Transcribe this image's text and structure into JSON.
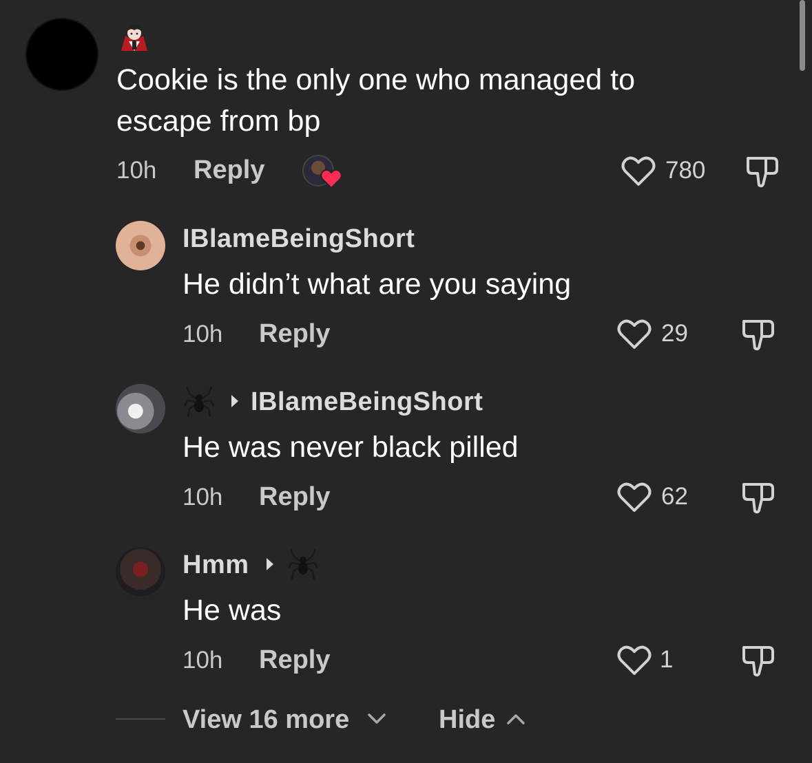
{
  "colors": {
    "background": "#262626",
    "text": "#ffffff",
    "muted": "#c9c9c9",
    "heart_badge": "#fe2c55"
  },
  "comments": [
    {
      "emoji_icon": "vampire-icon",
      "text_line1": "Cookie is the only one who managed to",
      "text_line2": "escape from bp",
      "time": "10h",
      "reply": "Reply",
      "likes": "780",
      "creator_liked": true
    },
    {
      "author": "IBlameBeingShort",
      "text": "He didn’t what are you saying",
      "time": "10h",
      "reply": "Reply",
      "likes": "29"
    },
    {
      "author_icon": "spider-icon",
      "reply_to": "IBlameBeingShort",
      "text": "He was never black pilled",
      "time": "10h",
      "reply": "Reply",
      "likes": "62"
    },
    {
      "author": "Hmm",
      "reply_to_icon": "spider-icon",
      "text": "He was",
      "time": "10h",
      "reply": "Reply",
      "likes": "1"
    }
  ],
  "footer": {
    "view_more": "View 16 more",
    "hide": "Hide"
  }
}
